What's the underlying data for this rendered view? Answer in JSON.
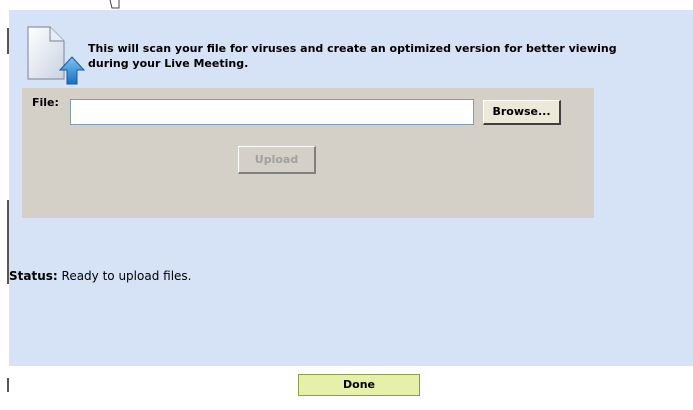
{
  "dialog": {
    "intro_text": "This will scan your file for viruses and create an optimized version for better viewing during your Live Meeting."
  },
  "form": {
    "file_label": "File:",
    "file_value": "",
    "browse_label": "Browse...",
    "upload_label": "Upload"
  },
  "status": {
    "label": "Status:",
    "text": " Ready to upload files."
  },
  "footer": {
    "done_label": "Done"
  },
  "icons": {
    "document": "document-upload-icon"
  },
  "colors": {
    "panel_bg": "#d6e2f5",
    "box_bg": "#d4d0c8",
    "done_bg": "#e6f0a8",
    "upload_arrow": "#2a8fd8"
  }
}
